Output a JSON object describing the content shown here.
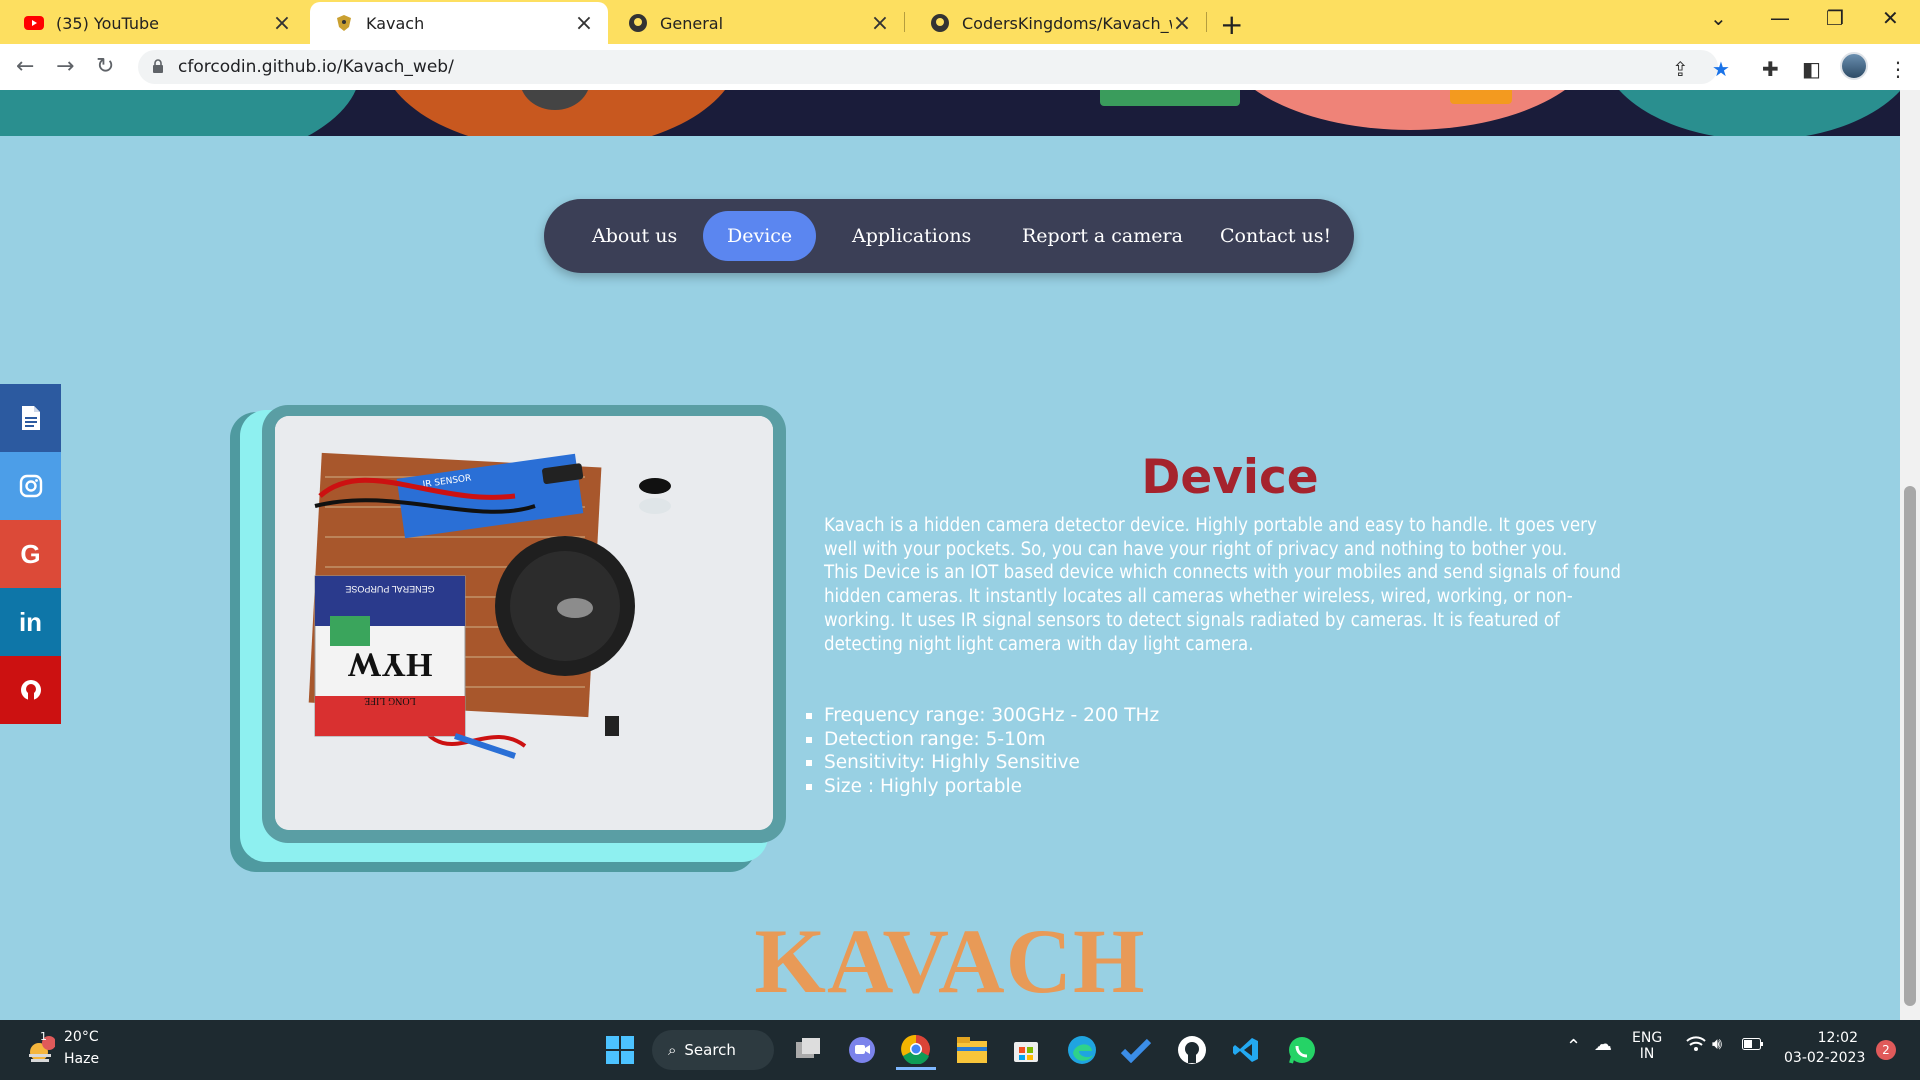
{
  "browser": {
    "tabs": [
      {
        "title": "(35) YouTube",
        "icon": "youtube-icon"
      },
      {
        "title": "Kavach",
        "icon": "kavach-favicon"
      },
      {
        "title": "General",
        "icon": "github-icon"
      },
      {
        "title": "CodersKingdoms/Kavach_web",
        "icon": "github-icon"
      }
    ],
    "url": "cforcodin.github.io/Kavach_web/"
  },
  "nav": {
    "items": [
      "About us",
      "Device",
      "Applications",
      "Report a camera",
      "Contact us!"
    ],
    "active": "Device"
  },
  "social": {
    "items": [
      {
        "icon": "document-icon",
        "color": "#2c5aa0"
      },
      {
        "icon": "instagram-icon",
        "color": "#4c9ee8"
      },
      {
        "icon": "google-icon",
        "color": "#dc4a38"
      },
      {
        "icon": "linkedin-icon",
        "color": "#0e76a8"
      },
      {
        "icon": "github-icon",
        "color": "#cc1111"
      }
    ],
    "google_glyph": "G",
    "linkedin_glyph": "in"
  },
  "device": {
    "title": "Device",
    "paragraph1": "Kavach is a hidden camera detector device. Highly portable and easy to handle. It goes very well with your pockets. So, you can have your right of privacy and nothing to bother you.",
    "paragraph2": "This Device is an IOT based device which connects with your mobiles and send signals of found hidden cameras. It instantly locates all cameras whether wireless, wired, working, or non-working. It uses IR signal sensors to detect signals radiated by cameras. It is featured of detecting night light camera with day light camera.",
    "specs": [
      "Frequency range: 300GHz - 200 THz",
      "Detection range: 5-10m",
      "Sensitivity: Highly Sensitive",
      "Size : Highly portable"
    ],
    "photo_labels": {
      "sensor": "IR SENSOR",
      "battery_brand": "HYW",
      "battery_tag": "LONG LIFE",
      "battery_purpose": "GENERAL PURPOSE"
    }
  },
  "footer_logo": "KAVACH",
  "taskbar": {
    "weather_temp": "20°C",
    "weather_cond": "Haze",
    "weather_badge": "1",
    "search_label": "Search",
    "lang_line1": "ENG",
    "lang_line2": "IN",
    "time": "12:02",
    "date": "03-02-2023",
    "notifications": "2"
  },
  "colors": {
    "page_bg": "#98d0e3",
    "nav_bg": "#3b3f56",
    "nav_active": "#5b86f0",
    "title_red": "#a5232d",
    "logo_orange": "#e89a57",
    "tab_bar": "#fddf60"
  }
}
